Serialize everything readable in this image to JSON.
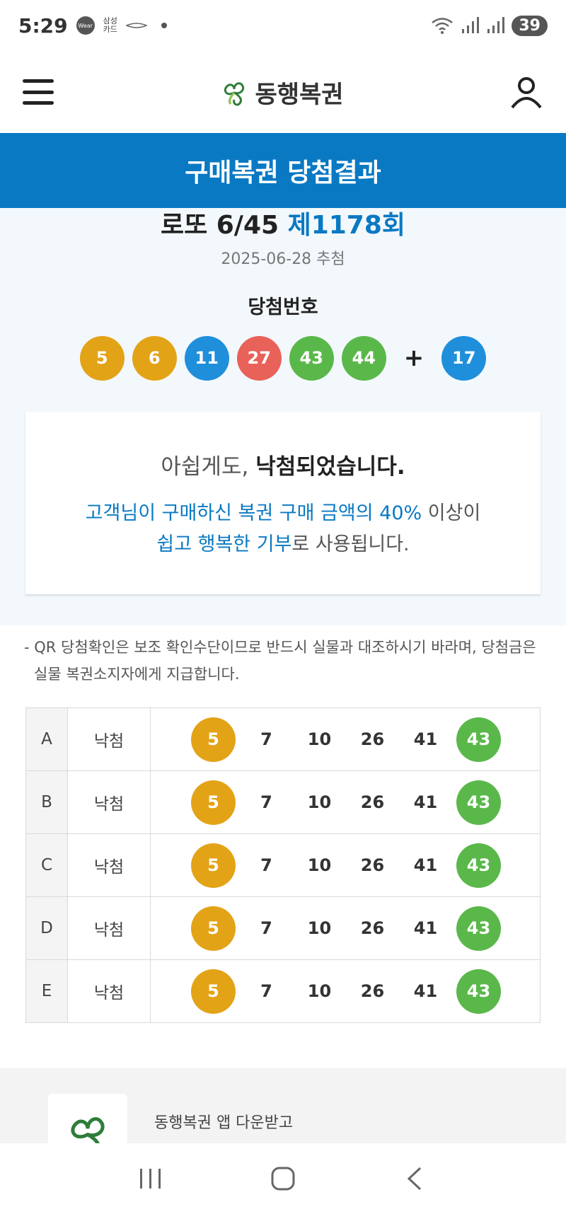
{
  "status": {
    "time": "5:29",
    "wear_label": "Wear",
    "card_label_1": "삼성",
    "card_label_2": "카드",
    "battery": "39"
  },
  "header": {
    "logo_text": "동행복권"
  },
  "title_band": {
    "title": "구매복권 당첨결과"
  },
  "round": {
    "game_name": "로또 6/45",
    "round_label": "제1178회",
    "draw_date": "2025-06-28 추첨",
    "win_numbers_label": "당첨번호",
    "plus": "+"
  },
  "winning_numbers": [
    {
      "n": "5",
      "color": "#e3a317"
    },
    {
      "n": "6",
      "color": "#e3a317"
    },
    {
      "n": "11",
      "color": "#1f8fdb"
    },
    {
      "n": "27",
      "color": "#e8625a"
    },
    {
      "n": "43",
      "color": "#5ab84a"
    },
    {
      "n": "44",
      "color": "#5ab84a"
    }
  ],
  "bonus_number": {
    "n": "17",
    "color": "#1f8fdb"
  },
  "result": {
    "main_prefix": "아쉽게도, ",
    "main_bold": "낙첨되었습니다.",
    "sub_blue_1": "고객님이 구매하신 복권 구매 금액의 40%",
    "sub_plain_1": " 이상이",
    "sub_blue_2": "쉽고 행복한 기부",
    "sub_plain_2": "로 사용됩니다."
  },
  "notice": "- QR 당첨확인은 보조 확인수단이므로 반드시 실물과 대조하시기 바라며, 당첨금은 실물 복권소지자에게 지급합니다.",
  "tickets": [
    {
      "game": "A",
      "result": "낙첨",
      "numbers": [
        "5",
        "7",
        "10",
        "26",
        "41",
        "43"
      ],
      "hits": [
        true,
        false,
        false,
        false,
        false,
        true
      ]
    },
    {
      "game": "B",
      "result": "낙첨",
      "numbers": [
        "5",
        "7",
        "10",
        "26",
        "41",
        "43"
      ],
      "hits": [
        true,
        false,
        false,
        false,
        false,
        true
      ]
    },
    {
      "game": "C",
      "result": "낙첨",
      "numbers": [
        "5",
        "7",
        "10",
        "26",
        "41",
        "43"
      ],
      "hits": [
        true,
        false,
        false,
        false,
        false,
        true
      ]
    },
    {
      "game": "D",
      "result": "낙첨",
      "numbers": [
        "5",
        "7",
        "10",
        "26",
        "41",
        "43"
      ],
      "hits": [
        true,
        false,
        false,
        false,
        false,
        true
      ]
    },
    {
      "game": "E",
      "result": "낙첨",
      "numbers": [
        "5",
        "7",
        "10",
        "26",
        "41",
        "43"
      ],
      "hits": [
        true,
        false,
        false,
        false,
        false,
        true
      ]
    }
  ],
  "hit_colors": {
    "5": "#e3a317",
    "43": "#5ab84a"
  },
  "promo": {
    "line1": "동행복권 앱 다운받고"
  },
  "colors": {
    "brand_blue": "#0a79c3",
    "logo_green": "#2e7d3a"
  }
}
